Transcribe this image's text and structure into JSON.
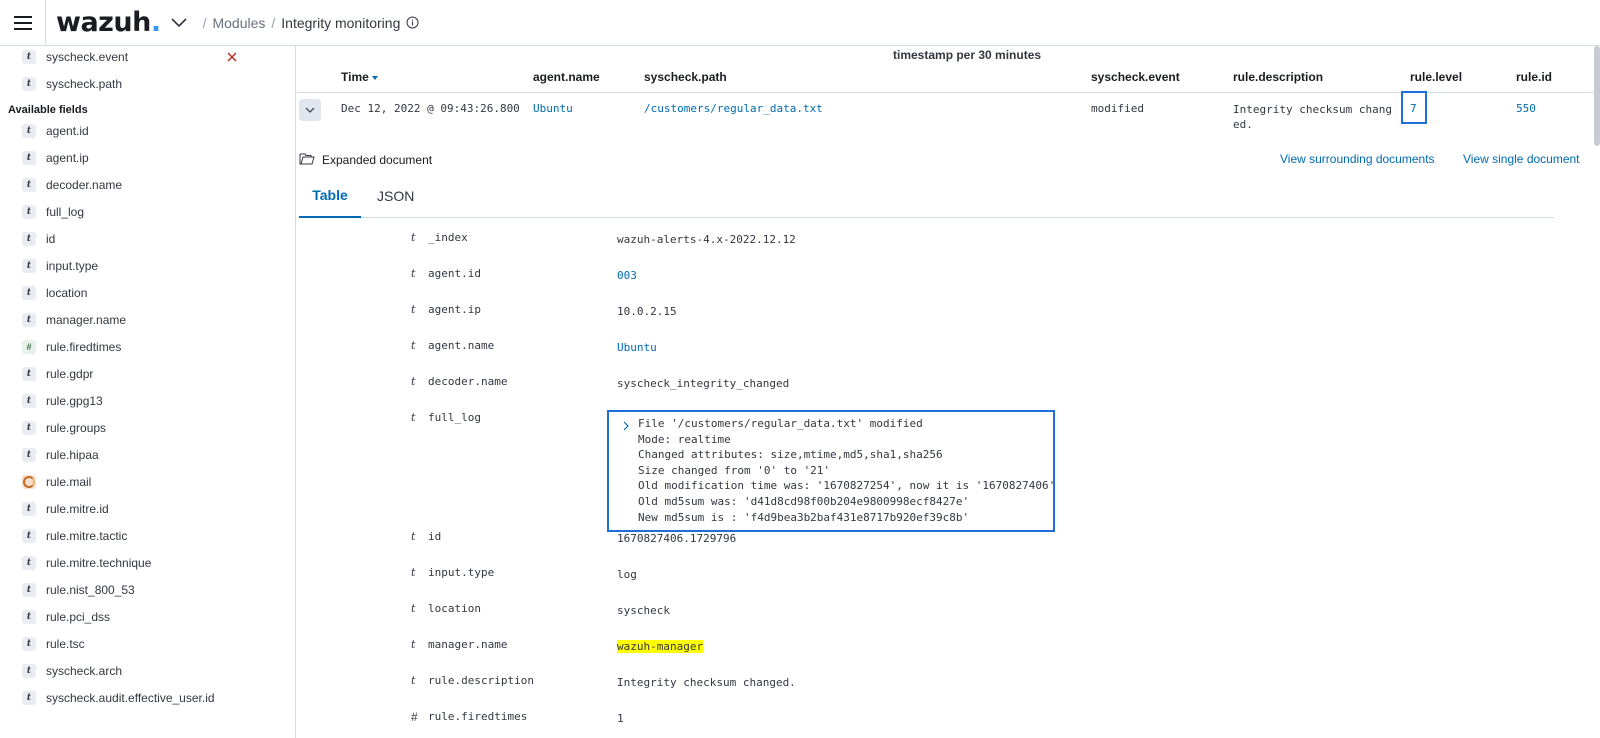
{
  "header": {
    "logo_text": "wazuh",
    "logo_dot": ".",
    "breadcrumbs": [
      "Modules",
      "Integrity monitoring"
    ],
    "icons": [
      "menu-icon",
      "chevron-down-icon",
      "info-icon"
    ]
  },
  "sidebar": {
    "selected_fields": [
      {
        "type": "t",
        "label": "syscheck.event"
      },
      {
        "type": "t",
        "label": "syscheck.path"
      }
    ],
    "available_title": "Available fields",
    "available_fields": [
      {
        "type": "t",
        "label": "agent.id"
      },
      {
        "type": "t",
        "label": "agent.ip"
      },
      {
        "type": "t",
        "label": "decoder.name"
      },
      {
        "type": "t",
        "label": "full_log"
      },
      {
        "type": "t",
        "label": "id"
      },
      {
        "type": "t",
        "label": "input.type"
      },
      {
        "type": "t",
        "label": "location"
      },
      {
        "type": "t",
        "label": "manager.name"
      },
      {
        "type": "#",
        "label": "rule.firedtimes"
      },
      {
        "type": "t",
        "label": "rule.gdpr"
      },
      {
        "type": "t",
        "label": "rule.gpg13"
      },
      {
        "type": "t",
        "label": "rule.groups"
      },
      {
        "type": "t",
        "label": "rule.hipaa"
      },
      {
        "type": "bool",
        "label": "rule.mail"
      },
      {
        "type": "t",
        "label": "rule.mitre.id"
      },
      {
        "type": "t",
        "label": "rule.mitre.tactic"
      },
      {
        "type": "t",
        "label": "rule.mitre.technique"
      },
      {
        "type": "t",
        "label": "rule.nist_800_53"
      },
      {
        "type": "t",
        "label": "rule.pci_dss"
      },
      {
        "type": "t",
        "label": "rule.tsc"
      },
      {
        "type": "t",
        "label": "syscheck.arch"
      },
      {
        "type": "t",
        "label": "syscheck.audit.effective_user.id"
      }
    ]
  },
  "main": {
    "chart_title": "timestamp per 30 minutes",
    "columns": [
      "Time",
      "agent.name",
      "syscheck.path",
      "syscheck.event",
      "rule.description",
      "rule.level",
      "rule.id"
    ],
    "row": {
      "time": "Dec 12, 2022 @ 09:43:26.800",
      "agent_name": "Ubuntu",
      "path": "/customers/regular_data.txt",
      "event": "modified",
      "description": "Integrity checksum changed.",
      "level": "7",
      "rule_id": "550"
    },
    "expanded": {
      "title": "Expanded document",
      "surrounding_link": "View surrounding documents",
      "single_link": "View single document",
      "tabs": [
        "Table",
        "JSON"
      ],
      "fields": [
        {
          "type": "t",
          "key": "_index",
          "value": "wazuh-alerts-4.x-2022.12.12"
        },
        {
          "type": "t",
          "key": "agent.id",
          "value": "003"
        },
        {
          "type": "t",
          "key": "agent.ip",
          "value": "10.0.2.15"
        },
        {
          "type": "t",
          "key": "agent.name",
          "value": "Ubuntu"
        },
        {
          "type": "t",
          "key": "decoder.name",
          "value": "syscheck_integrity_changed"
        },
        {
          "type": "t",
          "key": "full_log",
          "value": ""
        },
        {
          "type": "t",
          "key": "id",
          "value": "1670827406.1729796"
        },
        {
          "type": "t",
          "key": "input.type",
          "value": "log"
        },
        {
          "type": "t",
          "key": "location",
          "value": "syscheck"
        },
        {
          "type": "t",
          "key": "manager.name",
          "value": "wazuh-manager"
        },
        {
          "type": "t",
          "key": "rule.description",
          "value": "Integrity checksum changed."
        },
        {
          "type": "#",
          "key": "rule.firedtimes",
          "value": "1"
        }
      ],
      "full_log_lines": [
        "File '/customers/regular_data.txt' modified",
        "Mode: realtime",
        "Changed attributes: size,mtime,md5,sha1,sha256",
        "Size changed from '0' to '21'",
        "Old modification time was: '1670827254', now it is '1670827406'",
        "Old md5sum was: 'd41d8cd98f00b204e9800998ecf8427e'",
        "New md5sum is : 'f4d9bea3b2baf431e8717b920ef39c8b'"
      ]
    }
  }
}
